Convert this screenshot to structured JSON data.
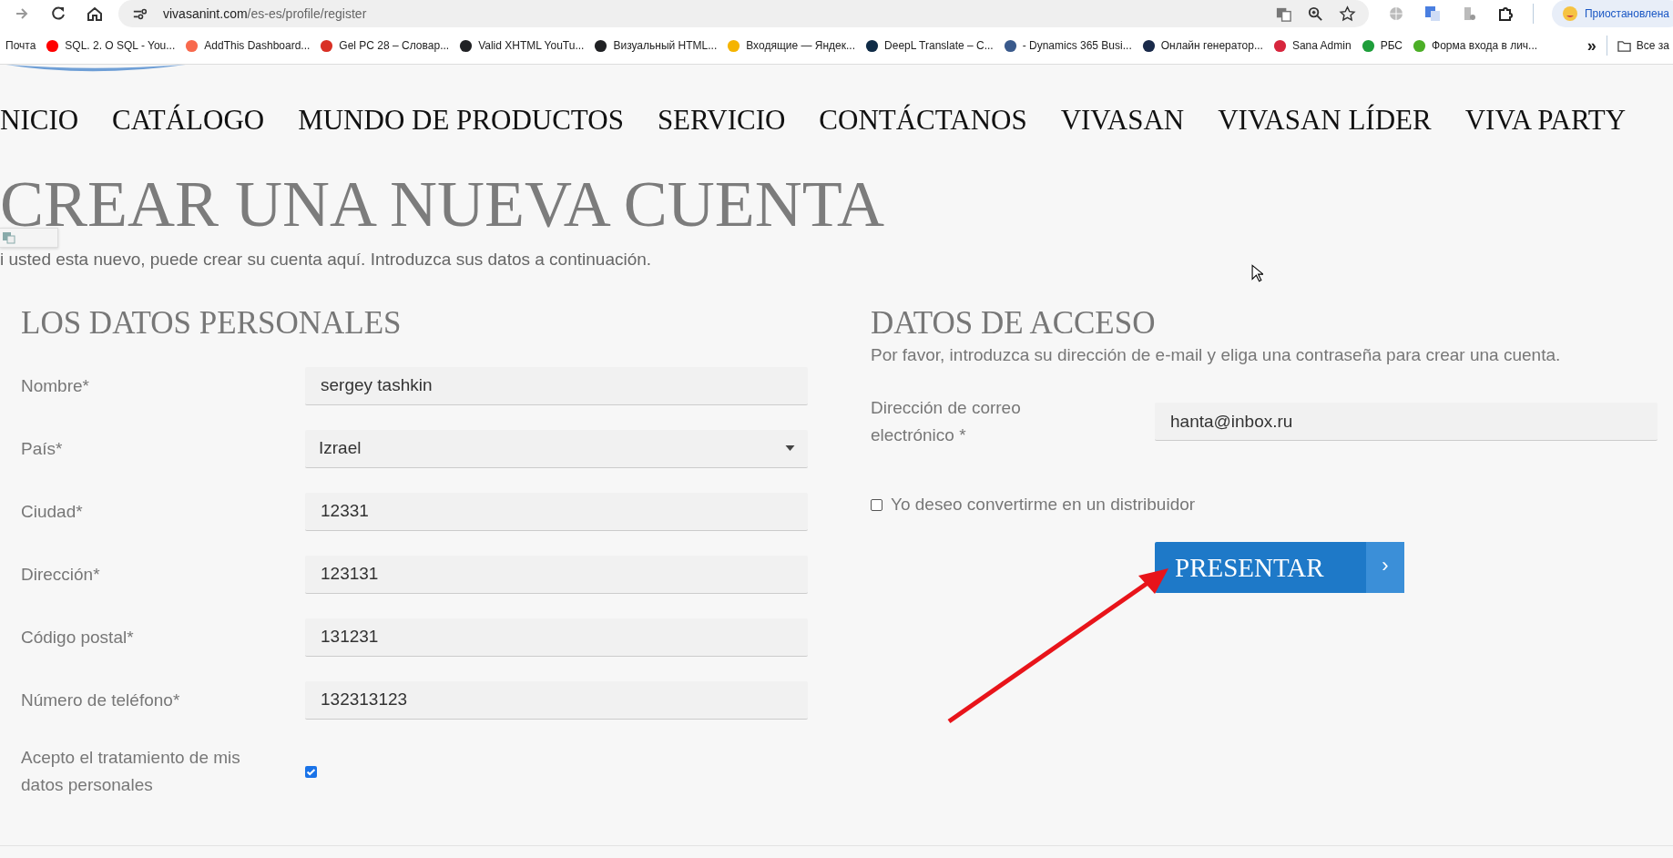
{
  "browser": {
    "url_domain": "vivasanint.com",
    "url_path": "/es-es/profile/register",
    "profile_label": "Приостановлена"
  },
  "bookmarks": [
    {
      "label": "Почта"
    },
    {
      "label": "SQL. 2. O SQL - You...",
      "color": "#ff0000"
    },
    {
      "label": "AddThis Dashboard...",
      "color": "#f8694d"
    },
    {
      "label": "Gel PC 28 – Словар...",
      "color": "#d93025"
    },
    {
      "label": "Valid XHTML YouTu...",
      "color": "#202124"
    },
    {
      "label": "Визуальный HTML...",
      "color": "#202124"
    },
    {
      "label": "Входящие — Яндек...",
      "color": "#f5b400"
    },
    {
      "label": "DeepL Translate – C...",
      "color": "#0f2b46"
    },
    {
      "label": "- Dynamics 365 Busi...",
      "color": "#3a5a8c"
    },
    {
      "label": "Онлайн генератор...",
      "color": "#1a2a4a"
    },
    {
      "label": "Sana Admin",
      "color": "#d7263d"
    },
    {
      "label": "РБС",
      "color": "#1e9e3a"
    },
    {
      "label": "Форма входа в лич...",
      "color": "#4caf27"
    }
  ],
  "bookmarks_more": "»",
  "all_bookmarks": "Все за",
  "nav": [
    "NICIO",
    "CATÁLOGO",
    "MUNDO DE PRODUCTOS",
    "SERVICIO",
    "CONTÁCTANOS",
    "VIVASAN",
    "VIVASAN LÍDER",
    "VIVA PARTY"
  ],
  "page": {
    "title": "CREAR UNA NUEVA CUENTA",
    "intro": "i usted esta nuevo, puede crear su cuenta aquí. Introduzca sus datos a continuación."
  },
  "personal": {
    "title": "LOS DATOS PERSONALES",
    "fields": [
      {
        "label": "Nombre*",
        "value": "sergey tashkin",
        "kind": "text"
      },
      {
        "label": "País*",
        "value": "Izrael",
        "kind": "select"
      },
      {
        "label": "Ciudad*",
        "value": "12331",
        "kind": "text"
      },
      {
        "label": "Dirección*",
        "value": "123131",
        "kind": "text"
      },
      {
        "label": "Código postal*",
        "value": "131231",
        "kind": "text"
      },
      {
        "label": "Número de teléfono*",
        "value": "132313123",
        "kind": "text"
      }
    ],
    "consent": {
      "label": "Acepto el tratamiento de mis datos personales",
      "checked": true
    }
  },
  "access": {
    "title": "DATOS DE ACCESO",
    "intro": "Por favor, introduzca su dirección de e-mail y eliga una contraseña para crear una cuenta.",
    "email": {
      "label": "Dirección de correo electrónico *",
      "value": "hanta@inbox.ru"
    },
    "distributor": {
      "label": "Yo deseo convertirme en un distribuidor",
      "checked": false
    },
    "submit": {
      "label": "PRESENTAR",
      "arrow": "›"
    }
  }
}
